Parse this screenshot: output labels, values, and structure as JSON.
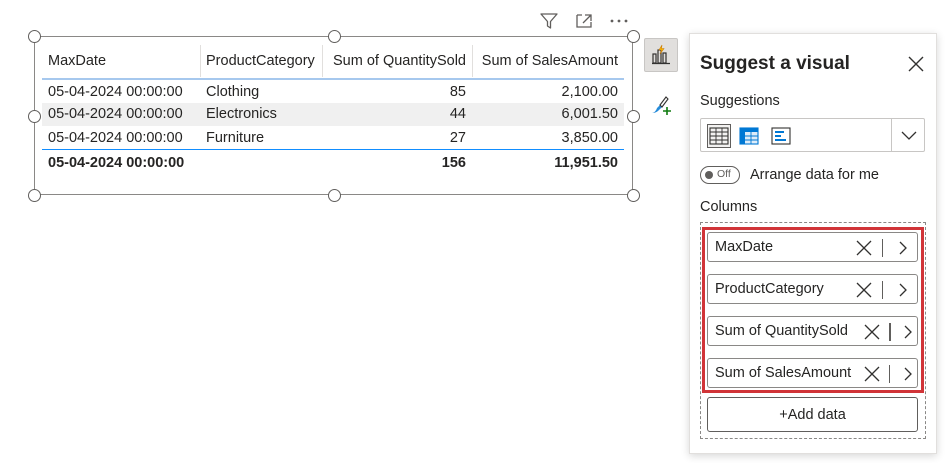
{
  "table": {
    "columns": [
      "MaxDate",
      "ProductCategory",
      "Sum of QuantitySold",
      "Sum of SalesAmount"
    ],
    "rows": [
      [
        "05-04-2024 00:00:00",
        "Clothing",
        "85",
        "2,100.00"
      ],
      [
        "05-04-2024 00:00:00",
        "Electronics",
        "44",
        "6,001.50"
      ],
      [
        "05-04-2024 00:00:00",
        "Furniture",
        "27",
        "3,850.00"
      ]
    ],
    "total": [
      "05-04-2024 00:00:00",
      "",
      "156",
      "11,951.50"
    ]
  },
  "toolbar_icons": [
    "filter-icon",
    "focus-mode-icon",
    "more-options-icon"
  ],
  "side_icons": [
    "suggest-visual-icon",
    "format-visual-icon"
  ],
  "panel": {
    "title": "Suggest a visual",
    "suggestions_label": "Suggestions",
    "suggestion_icons": [
      "table-icon",
      "matrix-icon",
      "list-slicer-icon"
    ],
    "toggle_text": "Off",
    "arrange_label": "Arrange data for me",
    "columns_label": "Columns",
    "columns": [
      {
        "name": "MaxDate"
      },
      {
        "name": "ProductCategory"
      },
      {
        "name": "Sum of QuantitySold"
      },
      {
        "name": "Sum of SalesAmount"
      }
    ],
    "add_data_label": "+Add data"
  },
  "colors": {
    "accent_blue": "#118dff",
    "header_underline": "#a6c8ee",
    "highlight_red": "#d13438",
    "row_alt": "#f0f0f0"
  }
}
